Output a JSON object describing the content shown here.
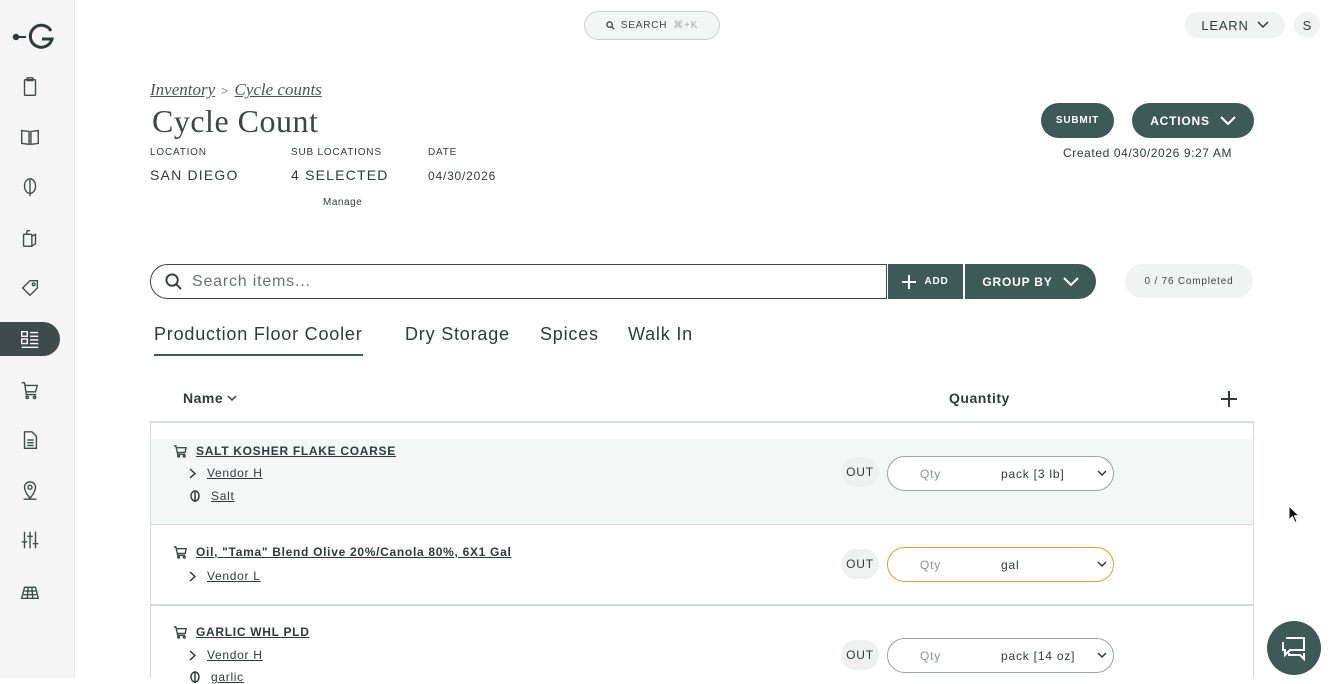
{
  "search": {
    "label": "SEARCH",
    "shortcut": "⌘+K"
  },
  "learn": {
    "label": "LEARN"
  },
  "avatar": {
    "initial": "S"
  },
  "breadcrumb": {
    "inventory": "Inventory",
    "separator": ">",
    "cycle_counts": "Cycle counts"
  },
  "page": {
    "title": "Cycle Count"
  },
  "meta": {
    "location_label": "LOCATION",
    "location_value": "SAN DIEGO",
    "sublocations_label": "SUB LOCATIONS",
    "sublocations_value": "4 SELECTED",
    "date_label": "DATE",
    "date_value": "04/30/2026",
    "manage": "Manage"
  },
  "actions": {
    "submit": "SUBMIT",
    "actions": "ACTIONS",
    "created": "Created 04/30/2026 9:27 AM"
  },
  "toolbar": {
    "search_placeholder": "Search items...",
    "add": "ADD",
    "group_by": "GROUP BY",
    "completed": "0 / 76 Completed"
  },
  "tabs": [
    "Production Floor Cooler",
    "Dry Storage",
    "Spices",
    "Walk In"
  ],
  "table": {
    "name_header": "Name",
    "quantity_header": "Quantity"
  },
  "rows": [
    {
      "name": "SALT KOSHER FLAKE COARSE",
      "vendor": "Vendor H",
      "ingredient": "Salt",
      "out": "OUT",
      "qty_placeholder": "Qty",
      "unit": "pack [3 lb]"
    },
    {
      "name": "Oil, \"Tama\" Blend Olive 20%/Canola 80%, 6X1 Gal",
      "vendor": "Vendor L",
      "out": "OUT",
      "qty_placeholder": "Qty",
      "unit": "gal"
    },
    {
      "name": "GARLIC WHL PLD",
      "vendor": "Vendor H",
      "ingredient": "garlic",
      "out": "OUT",
      "qty_placeholder": "Qty",
      "unit": "pack [14 oz]"
    }
  ],
  "colors": {
    "accent": "#3e5a57",
    "highlight_row": "#f3f8f7",
    "focus_border": "#d4a14a"
  }
}
